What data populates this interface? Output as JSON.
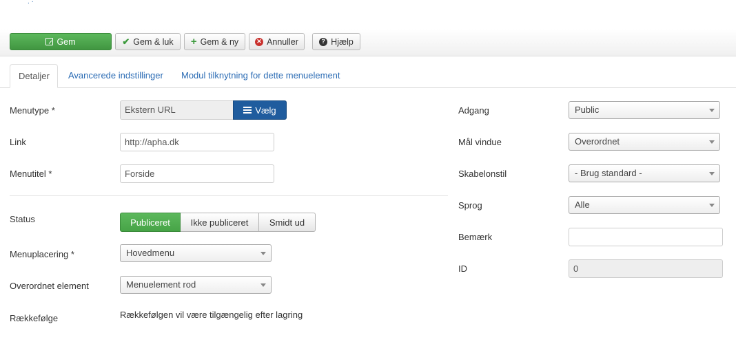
{
  "toolbar": {
    "save": "Gem",
    "save_close": "Gem & luk",
    "save_new": "Gem & ny",
    "cancel": "Annuller",
    "help": "Hjælp"
  },
  "tabs": [
    {
      "label": "Detaljer",
      "active": true
    },
    {
      "label": "Avancerede indstillinger",
      "active": false
    },
    {
      "label": "Modul tilknytning for dette menuelement",
      "active": false
    }
  ],
  "left": {
    "menutype": {
      "label": "Menutype *",
      "value": "Ekstern URL",
      "button": "Vælg"
    },
    "link": {
      "label": "Link",
      "value": "http://apha.dk"
    },
    "menutitel": {
      "label": "Menutitel *",
      "value": "Forside"
    },
    "status": {
      "label": "Status",
      "options": [
        "Publiceret",
        "Ikke publiceret",
        "Smidt ud"
      ],
      "selected": "Publiceret"
    },
    "menuplacering": {
      "label": "Menuplacering *",
      "value": "Hovedmenu"
    },
    "overordnet": {
      "label": "Overordnet element",
      "value": "Menuelement rod"
    },
    "raekkefolge": {
      "label": "Rækkefølge",
      "value": "Rækkefølgen vil være tilgængelig efter lagring"
    }
  },
  "right": {
    "adgang": {
      "label": "Adgang",
      "value": "Public"
    },
    "maal_vindue": {
      "label": "Mål vindue",
      "value": "Overordnet"
    },
    "skabelonstil": {
      "label": "Skabelonstil",
      "value": "- Brug standard -"
    },
    "sprog": {
      "label": "Sprog",
      "value": "Alle"
    },
    "bemaerk": {
      "label": "Bemærk",
      "value": ""
    },
    "id": {
      "label": "ID",
      "value": "0"
    }
  },
  "colors": {
    "green": "#5cb85c",
    "blue": "#1f5c9e",
    "link": "#2a6bb4"
  }
}
